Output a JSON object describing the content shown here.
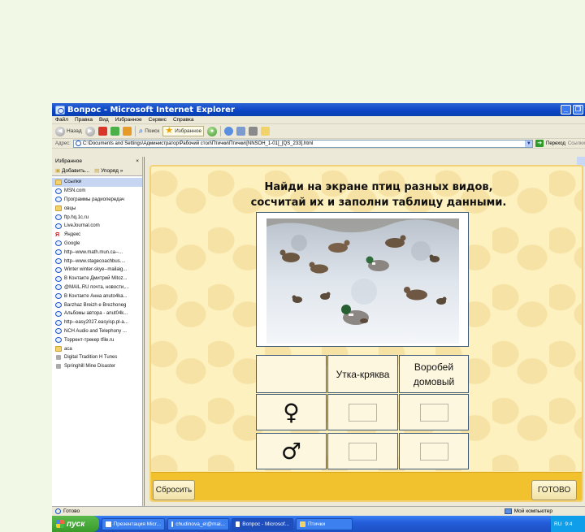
{
  "window": {
    "title": "Вопрос - Microsoft Internet Explorer"
  },
  "menu": [
    "Файл",
    "Правка",
    "Вид",
    "Избранное",
    "Сервис",
    "Справка"
  ],
  "toolbar": {
    "back": "Назад",
    "search": "Поиск",
    "favorites": "Избранное"
  },
  "address": {
    "label": "Адрес:",
    "url": "C:\\Documents and Settings\\Администратор\\Рабочий стол\\Птички\\Птички\\[NNSOH_1-01]_[QS_233].html",
    "go": "Переход",
    "links": "Ссылки"
  },
  "sidebar": {
    "title": "Избранное",
    "close": "×",
    "add": "Добавить...",
    "organize": "Упоряд",
    "more": "»",
    "items": [
      {
        "label": "Ссылки",
        "icon": "folder"
      },
      {
        "label": "MSN.com",
        "icon": "ie"
      },
      {
        "label": "Программы радиопередач",
        "icon": "ie"
      },
      {
        "label": "овцы",
        "icon": "folder"
      },
      {
        "label": "ftp.hq.1c.ru",
        "icon": "ie"
      },
      {
        "label": "LiveJournal.com",
        "icon": "ie"
      },
      {
        "label": "Яндекс",
        "icon": "yandex"
      },
      {
        "label": "Google",
        "icon": "ie"
      },
      {
        "label": "http--www.math.mun.ca--...",
        "icon": "ie"
      },
      {
        "label": "http--www.stagecoachbus....",
        "icon": "ie"
      },
      {
        "label": "Winter winter-skye--mailaig...",
        "icon": "ie"
      },
      {
        "label": "В Контакте Дмитрий Mitoz...",
        "icon": "ie"
      },
      {
        "label": "@MAIL.RU почта, новости,...",
        "icon": "ie"
      },
      {
        "label": "В Контакте Анна anuto4ka...",
        "icon": "ie"
      },
      {
        "label": "Barzhaz Breizh e Brezhoneg",
        "icon": "ie"
      },
      {
        "label": "Альбомы автора - anut04k...",
        "icon": "ie"
      },
      {
        "label": "http--easy2027.easyisp.pl-a...",
        "icon": "ie"
      },
      {
        "label": "NCH Audio and Telephony ...",
        "icon": "ie"
      },
      {
        "label": "Торрент-трекер tfile.ru",
        "icon": "ie"
      },
      {
        "label": "aca",
        "icon": "folder"
      },
      {
        "label": "Digital Tradition H Tunes",
        "icon": "media"
      },
      {
        "label": "Springhill Mine Disaster",
        "icon": "media"
      }
    ]
  },
  "quiz": {
    "title_line1": "Найди на экране птиц разных видов,",
    "title_line2": "сосчитай их и заполни таблицу данными.",
    "col1": "Утка-кряква",
    "col2_line1": "Воробей",
    "col2_line2": "домовый",
    "female_symbol": "♀",
    "male_symbol": "♂",
    "inputs": {
      "female_mallard": "",
      "female_sparrow": "",
      "male_mallard": "",
      "male_sparrow": ""
    },
    "reset": "Сбросить",
    "done": "ГОТОВО"
  },
  "status": {
    "left": "Готово",
    "right": "Мой компьютер"
  },
  "taskbar": {
    "start": "пуск",
    "tasks": [
      "Презентация Micr...",
      "chudinova_el@mai...",
      "Вопрос - Microsof...",
      "Птички"
    ],
    "lang": "RU",
    "time": "9:4"
  },
  "colors": {
    "titlebar": "#0a44c2",
    "quiz_panel": "#fdf1c0",
    "quiz_bar": "#f2c12e",
    "table_border": "#3c5a78"
  }
}
